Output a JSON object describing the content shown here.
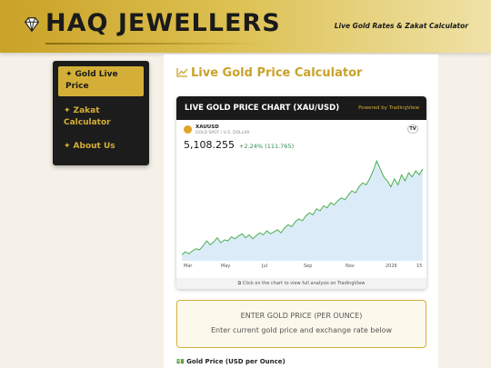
{
  "header": {
    "brand": "HAQ JEWELLERS",
    "tagline": "Live Gold Rates & Zakat Calculator",
    "logo_icon": "diamond-icon"
  },
  "sidebar": {
    "items": [
      {
        "label": "Gold Live Price",
        "icon": "sparkle-icon",
        "active": true
      },
      {
        "label": "Zakat Calculator",
        "icon": "sparkle-icon",
        "active": false
      },
      {
        "label": "About Us",
        "icon": "sparkle-icon",
        "active": false
      }
    ]
  },
  "main": {
    "title": "Live Gold Price Calculator",
    "title_icon": "trend-chart-icon"
  },
  "chart_card": {
    "title": "LIVE GOLD PRICE CHART (XAU/USD)",
    "powered": "Powered by TradingView",
    "symbol": "XAUUSD",
    "symbol_sub": "GOLD SPOT / U.S. DOLLAR",
    "price": "5,108.255",
    "change": "+2.24% (111.765)",
    "tv_logo": "TV",
    "footer": "Click on the chart to view full analysis on TradingView"
  },
  "chart_data": {
    "type": "area",
    "x_ticks": [
      "Mar",
      "May",
      "Jul",
      "Sep",
      "Nov",
      "2026",
      "15"
    ],
    "points": [
      0.06,
      0.09,
      0.07,
      0.1,
      0.12,
      0.11,
      0.15,
      0.2,
      0.16,
      0.19,
      0.23,
      0.18,
      0.21,
      0.2,
      0.24,
      0.22,
      0.25,
      0.27,
      0.23,
      0.26,
      0.22,
      0.25,
      0.28,
      0.26,
      0.3,
      0.27,
      0.29,
      0.31,
      0.28,
      0.33,
      0.36,
      0.34,
      0.39,
      0.42,
      0.4,
      0.45,
      0.48,
      0.46,
      0.52,
      0.5,
      0.55,
      0.53,
      0.58,
      0.56,
      0.6,
      0.63,
      0.61,
      0.66,
      0.7,
      0.68,
      0.74,
      0.78,
      0.76,
      0.82,
      0.9,
      1.0,
      0.92,
      0.84,
      0.8,
      0.74,
      0.82,
      0.76,
      0.86,
      0.8,
      0.88,
      0.84,
      0.9,
      0.86,
      0.92
    ],
    "colors": {
      "line": "#4caf50",
      "fill": "#dcebf8"
    }
  },
  "enter_box": {
    "title": "ENTER GOLD PRICE (PER OUNCE)",
    "subtitle": "Enter current gold price and exchange rate below"
  },
  "form": {
    "gold_price_label": "Gold Price (USD per Ounce)",
    "gold_price_icon": "money-icon"
  },
  "colors": {
    "gold": "#d4af37",
    "dark": "#1a1a1a",
    "background": "#f5f1e8"
  }
}
